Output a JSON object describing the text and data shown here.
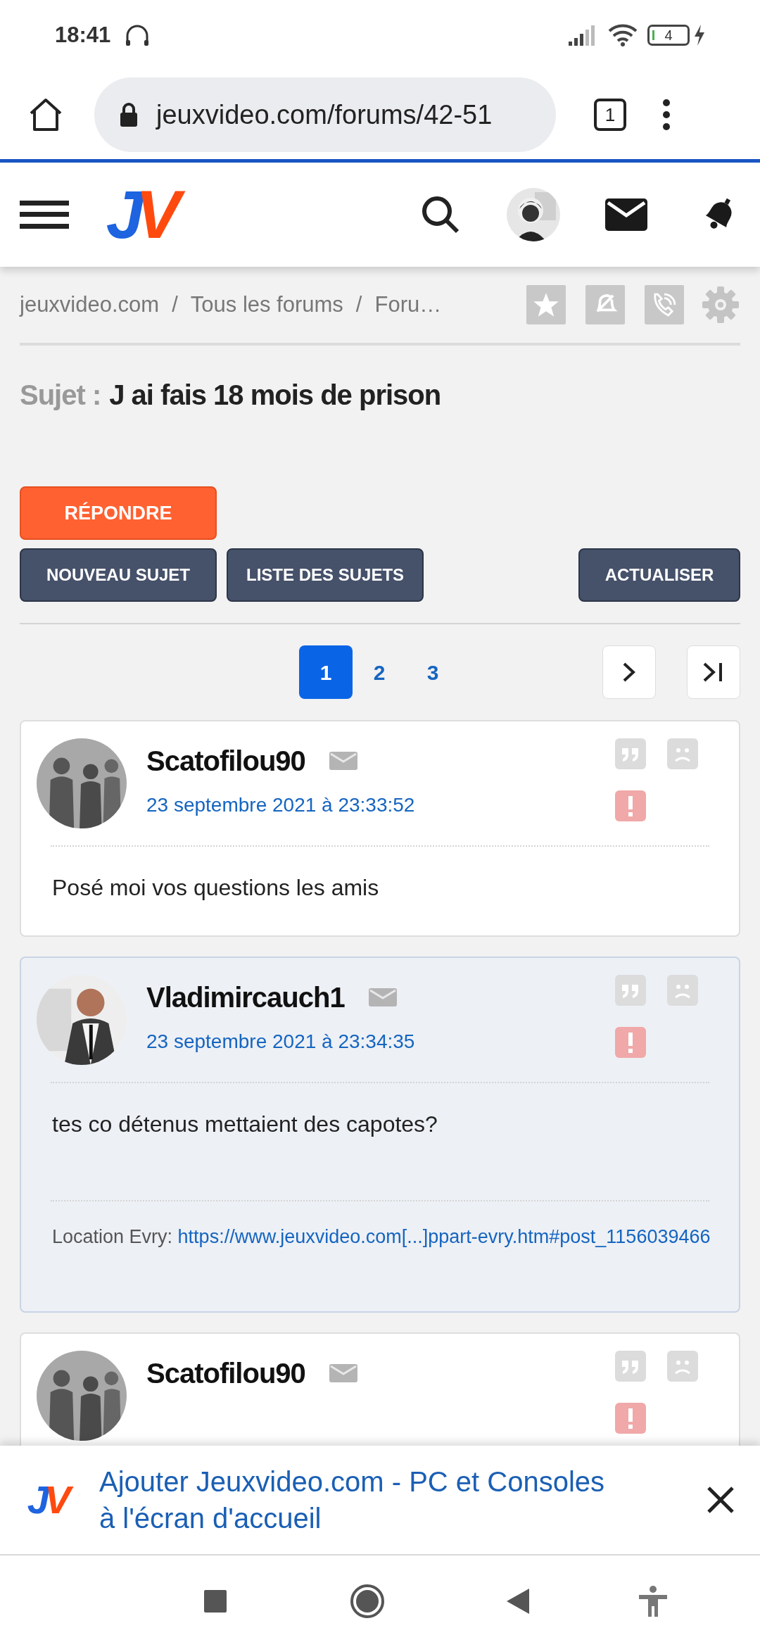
{
  "status_bar": {
    "time": "18:41",
    "battery": "4"
  },
  "browser": {
    "url": "jeuxvideo.com/forums/42-51",
    "tab_count": "1"
  },
  "site_header": {
    "logo": [
      "J",
      "V"
    ]
  },
  "breadcrumb": {
    "items": [
      "jeuxvideo.com",
      "Tous les forums",
      "Foru…"
    ],
    "separator": "/"
  },
  "topic": {
    "label": "Sujet :",
    "title": "J ai fais 18 mois de prison"
  },
  "reply_button": "RÉPONDRE",
  "buttons": [
    "NOUVEAU SUJET",
    "LISTE DES SUJETS",
    "ACTUALISER"
  ],
  "pagination": {
    "pages": [
      {
        "label": "1",
        "selected": true
      },
      {
        "label": "2",
        "selected": false
      },
      {
        "label": "3",
        "selected": false
      }
    ]
  },
  "posts": [
    {
      "author": "Scatofilou90",
      "date": "23 septembre 2021 à 23:33:52",
      "body": "Posé moi vos questions les amis",
      "highlighted": false
    },
    {
      "author": "Vladimircauch1",
      "date": "23 septembre 2021 à 23:34:35",
      "body": "tes co détenus mettaient des capotes?",
      "highlighted": true,
      "signature": {
        "label": "Location Evry:",
        "link": "https://www.jeuxvideo.com[...]ppart-evry.htm#post_1156039466"
      }
    },
    {
      "author": "Scatofilou90",
      "highlighted": false
    }
  ],
  "install_banner": {
    "logo": [
      "J",
      "V"
    ],
    "text": "Ajouter Jeuxvideo.com - PC et Consoles à l'écran d'accueil"
  }
}
